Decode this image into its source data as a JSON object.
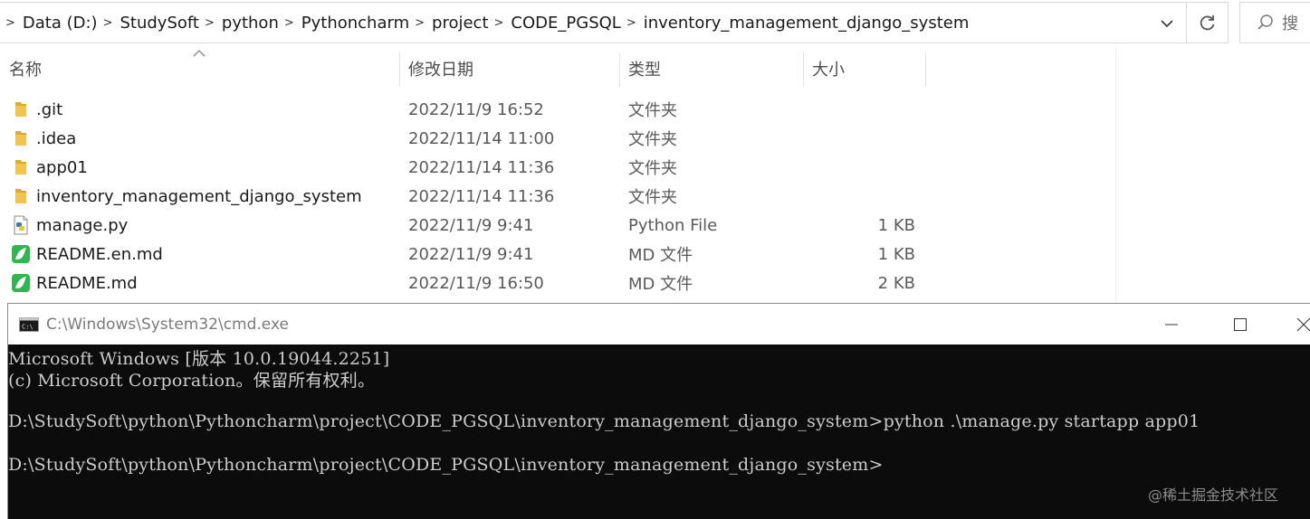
{
  "explorer": {
    "breadcrumb": [
      "Data (D:)",
      "StudySoft",
      "python",
      "Pythoncharm",
      "project",
      "CODE_PGSQL",
      "inventory_management_django_system"
    ],
    "search_placeholder": "搜",
    "columns": {
      "name": "名称",
      "date": "修改日期",
      "type": "类型",
      "size": "大小"
    },
    "files": [
      {
        "name": ".git",
        "date": "2022/11/9 16:52",
        "type": "文件夹",
        "size": "",
        "icon": "folder-icon"
      },
      {
        "name": ".idea",
        "date": "2022/11/14 11:00",
        "type": "文件夹",
        "size": "",
        "icon": "folder-icon"
      },
      {
        "name": "app01",
        "date": "2022/11/14 11:36",
        "type": "文件夹",
        "size": "",
        "icon": "folder-icon"
      },
      {
        "name": "inventory_management_django_system",
        "date": "2022/11/14 11:36",
        "type": "文件夹",
        "size": "",
        "icon": "folder-icon"
      },
      {
        "name": "manage.py",
        "date": "2022/11/9 9:41",
        "type": "Python File",
        "size": "1 KB",
        "icon": "python-file-icon"
      },
      {
        "name": "README.en.md",
        "date": "2022/11/9 9:41",
        "type": "MD 文件",
        "size": "1 KB",
        "icon": "markdown-file-icon"
      },
      {
        "name": "README.md",
        "date": "2022/11/9 16:50",
        "type": "MD 文件",
        "size": "2 KB",
        "icon": "markdown-file-icon"
      }
    ]
  },
  "cmd": {
    "title": "C:\\Windows\\System32\\cmd.exe",
    "lines": [
      "Microsoft Windows [版本 10.0.19044.2251]",
      "(c) Microsoft Corporation。保留所有权利。",
      "",
      "D:\\StudySoft\\python\\Pythoncharm\\project\\CODE_PGSQL\\inventory_management_django_system>python .\\manage.py startapp app01",
      "",
      "D:\\StudySoft\\python\\Pythoncharm\\project\\CODE_PGSQL\\inventory_management_django_system>"
    ]
  },
  "watermark": "@稀土掘金技术社区",
  "colors": {
    "folder": "#f3c44c",
    "folder_dark": "#e0a92a",
    "md_icon": "#2db84d",
    "cmd_bg": "#0c0c0c",
    "cmd_text": "#cccccc"
  }
}
